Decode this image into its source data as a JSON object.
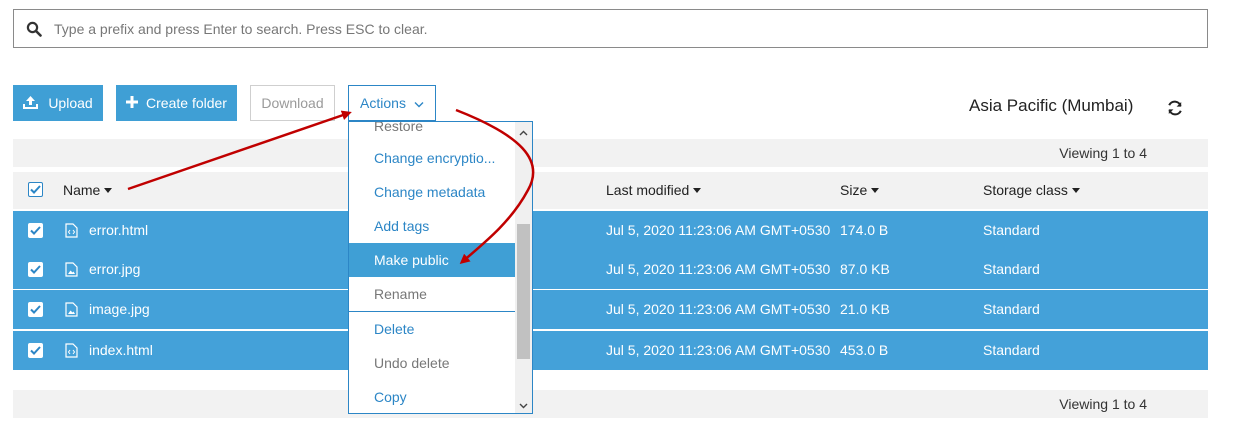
{
  "search": {
    "placeholder": "Type a prefix and press Enter to search. Press ESC to clear.",
    "value": ""
  },
  "toolbar": {
    "upload_label": "Upload",
    "create_folder_label": "Create folder",
    "download_label": "Download",
    "actions_label": "Actions"
  },
  "region": "Asia Pacific (Mumbai)",
  "pagination": {
    "top": "Viewing 1 to 4",
    "bottom": "Viewing 1 to 4"
  },
  "columns": {
    "name": "Name",
    "last_modified": "Last modified",
    "size": "Size",
    "storage_class": "Storage class"
  },
  "files": [
    {
      "name": "error.html",
      "type": "code",
      "modified": "Jul 5, 2020 11:23:06 AM GMT+0530",
      "size": "174.0 B",
      "storage": "Standard",
      "checked": true
    },
    {
      "name": "error.jpg",
      "type": "image",
      "modified": "Jul 5, 2020 11:23:06 AM GMT+0530",
      "size": "87.0 KB",
      "storage": "Standard",
      "checked": true
    },
    {
      "name": "image.jpg",
      "type": "image",
      "modified": "Jul 5, 2020 11:23:06 AM GMT+0530",
      "size": "21.0 KB",
      "storage": "Standard",
      "checked": true
    },
    {
      "name": "index.html",
      "type": "code",
      "modified": "Jul 5, 2020 11:23:06 AM GMT+0530",
      "size": "453.0 B",
      "storage": "Standard",
      "checked": true
    }
  ],
  "actions_menu": {
    "items": [
      {
        "label": "Restore",
        "state": "muted"
      },
      {
        "label": "Change encryptio...",
        "state": "link"
      },
      {
        "label": "Change metadata",
        "state": "link"
      },
      {
        "label": "Add tags",
        "state": "link"
      },
      {
        "label": "Make public",
        "state": "active"
      },
      {
        "label": "Rename",
        "state": "muted"
      },
      {
        "label": "Delete",
        "state": "link"
      },
      {
        "label": "Undo delete",
        "state": "muted"
      },
      {
        "label": "Copy",
        "state": "link"
      }
    ]
  },
  "colors": {
    "accent": "#2c86c6",
    "row_selected": "#44a1d9",
    "annotation_arrow": "#c00000"
  }
}
